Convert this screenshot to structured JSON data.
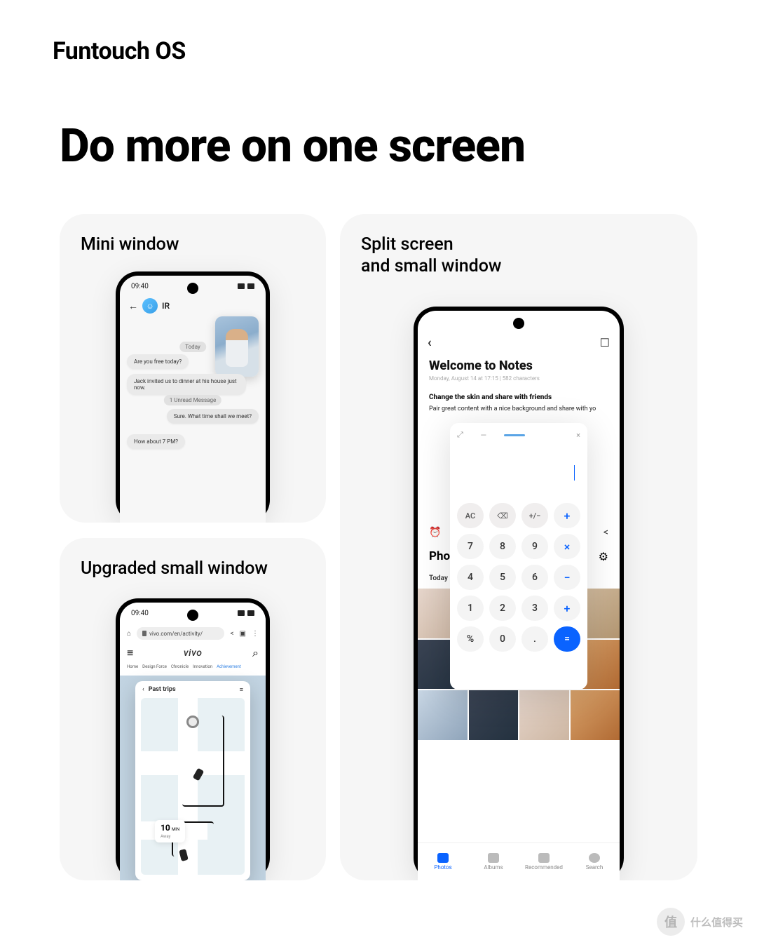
{
  "brand": "Funtouch OS",
  "headline": "Do more on one screen",
  "cards": {
    "mini": {
      "title": "Mini window"
    },
    "upgraded": {
      "title": "Upgraded small window"
    },
    "split": {
      "title": "Split screen\nand small window"
    }
  },
  "phone": {
    "time": "09:40",
    "chat": {
      "name": "IR",
      "pill_today": "Today",
      "msg_rx1": "Are you free today?",
      "msg_rx2": "Jack invited us to dinner at his house just now.",
      "pill_unread": "1 Unread Message",
      "msg_tx1": "Sure. What time shall we meet?",
      "msg_rx3": "How about 7 PM?"
    },
    "browser": {
      "url": "vivo.com/en/activity/",
      "logo": "vivo",
      "nav": [
        "Home",
        "Design Force",
        "Chronicle",
        "Innovation",
        "Achievement"
      ],
      "map_title": "Past trips",
      "eta_num": "10",
      "eta_unit_a": "MIN",
      "eta_unit_b": "Away"
    },
    "notes": {
      "title": "Welcome to Notes",
      "meta": "Monday, August 14 at 17:15  |  582 characters",
      "heading": "Change the skin and share with friends",
      "body": "Pair great content with a nice background and share with yo"
    },
    "photos": {
      "header": "Photos",
      "today": "Today",
      "tabs": [
        "Photos",
        "Albums",
        "Recommended",
        "Search"
      ]
    },
    "calc": {
      "ops": {
        "ac": "AC",
        "bs": "⌫",
        "pm": "+/−",
        "add": "+",
        "mul": "×",
        "sub": "−",
        "pct": "%",
        "dot": ".",
        "eq": "="
      },
      "nums": {
        "n0": "0",
        "n1": "1",
        "n2": "2",
        "n3": "3",
        "n4": "4",
        "n5": "5",
        "n6": "6",
        "n7": "7",
        "n8": "8",
        "n9": "9"
      }
    }
  },
  "watermark": {
    "glyph": "值",
    "text": "什么值得买"
  }
}
